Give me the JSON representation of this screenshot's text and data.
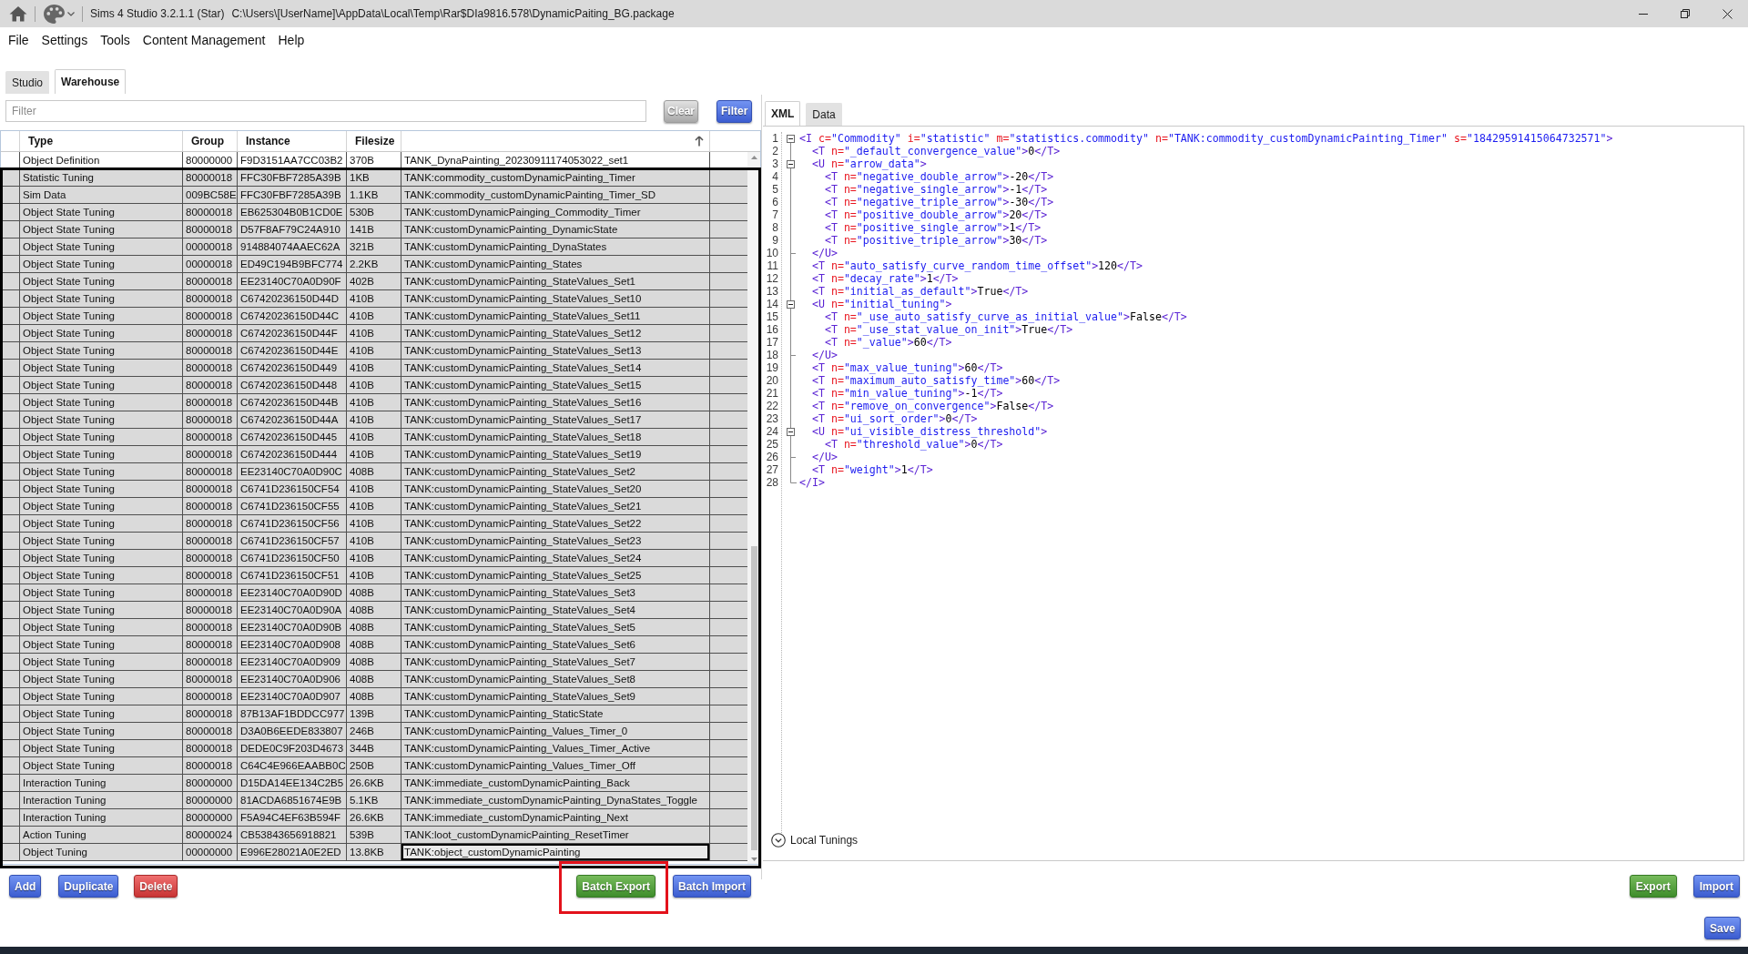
{
  "window": {
    "app_name": "Sims 4 Studio 3.2.1.1 (Star)",
    "file_path": "C:\\Users\\[UserName]\\AppData\\Local\\Temp\\Rar$DIa9816.578\\DynamicPaiting_BG.package"
  },
  "menu": [
    "File",
    "Settings",
    "Tools",
    "Content Management",
    "Help"
  ],
  "tabs": [
    {
      "label": "Studio",
      "selected": false
    },
    {
      "label": "Warehouse",
      "selected": true
    }
  ],
  "filter": {
    "placeholder": "Filter",
    "clear_button": {
      "label": "Clear",
      "disabled": true
    },
    "filter_button": {
      "label": "Filter"
    }
  },
  "table": {
    "highlighted": true,
    "columns": [
      {
        "label": "Type",
        "sorted": false
      },
      {
        "label": "Group",
        "sorted": false
      },
      {
        "label": "Instance",
        "sorted": false
      },
      {
        "label": "Filesize",
        "sorted": false
      },
      {
        "sorted": true
      }
    ],
    "rows": [
      {
        "type": "Object Definition",
        "group": "80000000",
        "instance": "F9D3151AA7CC03B2",
        "filesize": "370B",
        "column_5": "TANK_DynaPainting_20230911174053022_set1",
        "selected": false,
        "focused": false
      },
      {
        "type": "Statistic Tuning",
        "group": "80000018",
        "instance": "FFC30FBF7285A39B",
        "filesize": "1KB",
        "column_5": "TANK:commodity_customDynamicPainting_Timer",
        "selected": true,
        "focused": false
      },
      {
        "type": "Sim Data",
        "group": "009BC58E",
        "instance": "FFC30FBF7285A39B",
        "filesize": "1.1KB",
        "column_5": "TANK:commodity_customDynamicPainting_Timer_SD",
        "selected": true,
        "focused": false
      },
      {
        "type": "Object State Tuning",
        "group": "80000018",
        "instance": "EB625304B0B1CD0E",
        "filesize": "530B",
        "column_5": "TANK:customDynamicPainging_Commodity_Timer",
        "selected": true,
        "focused": false
      },
      {
        "type": "Object State Tuning",
        "group": "80000018",
        "instance": "D57F8AF79C24A910",
        "filesize": "141B",
        "column_5": "TANK:customDynamicPainting_DynamicState",
        "selected": true,
        "focused": false
      },
      {
        "type": "Object State Tuning",
        "group": "00000018",
        "instance": "914884074AAEC62A",
        "filesize": "321B",
        "column_5": "TANK:customDynamicPainting_DynaStates",
        "selected": true,
        "focused": false
      },
      {
        "type": "Object State Tuning",
        "group": "00000018",
        "instance": "ED49C194B9BFC774",
        "filesize": "2.2KB",
        "column_5": "TANK:customDynamicPainting_States",
        "selected": true,
        "focused": false
      },
      {
        "type": "Object State Tuning",
        "group": "80000018",
        "instance": "EE23140C70A0D90F",
        "filesize": "402B",
        "column_5": "TANK:customDynamicPainting_StateValues_Set1",
        "selected": true,
        "focused": false
      },
      {
        "type": "Object State Tuning",
        "group": "80000018",
        "instance": "C67420236150D44D",
        "filesize": "410B",
        "column_5": "TANK:customDynamicPainting_StateValues_Set10",
        "selected": true,
        "focused": false
      },
      {
        "type": "Object State Tuning",
        "group": "80000018",
        "instance": "C67420236150D44C",
        "filesize": "410B",
        "column_5": "TANK:customDynamicPainting_StateValues_Set11",
        "selected": true,
        "focused": false
      },
      {
        "type": "Object State Tuning",
        "group": "80000018",
        "instance": "C67420236150D44F",
        "filesize": "410B",
        "column_5": "TANK:customDynamicPainting_StateValues_Set12",
        "selected": true,
        "focused": false
      },
      {
        "type": "Object State Tuning",
        "group": "80000018",
        "instance": "C67420236150D44E",
        "filesize": "410B",
        "column_5": "TANK:customDynamicPainting_StateValues_Set13",
        "selected": true,
        "focused": false
      },
      {
        "type": "Object State Tuning",
        "group": "80000018",
        "instance": "C67420236150D449",
        "filesize": "410B",
        "column_5": "TANK:customDynamicPainting_StateValues_Set14",
        "selected": true,
        "focused": false
      },
      {
        "type": "Object State Tuning",
        "group": "80000018",
        "instance": "C67420236150D448",
        "filesize": "410B",
        "column_5": "TANK:customDynamicPainting_StateValues_Set15",
        "selected": true,
        "focused": false
      },
      {
        "type": "Object State Tuning",
        "group": "80000018",
        "instance": "C67420236150D44B",
        "filesize": "410B",
        "column_5": "TANK:customDynamicPainting_StateValues_Set16",
        "selected": true,
        "focused": false
      },
      {
        "type": "Object State Tuning",
        "group": "80000018",
        "instance": "C67420236150D44A",
        "filesize": "410B",
        "column_5": "TANK:customDynamicPainting_StateValues_Set17",
        "selected": true,
        "focused": false
      },
      {
        "type": "Object State Tuning",
        "group": "80000018",
        "instance": "C67420236150D445",
        "filesize": "410B",
        "column_5": "TANK:customDynamicPainting_StateValues_Set18",
        "selected": true,
        "focused": false
      },
      {
        "type": "Object State Tuning",
        "group": "80000018",
        "instance": "C67420236150D444",
        "filesize": "410B",
        "column_5": "TANK:customDynamicPainting_StateValues_Set19",
        "selected": true,
        "focused": false
      },
      {
        "type": "Object State Tuning",
        "group": "80000018",
        "instance": "EE23140C70A0D90C",
        "filesize": "408B",
        "column_5": "TANK:customDynamicPainting_StateValues_Set2",
        "selected": true,
        "focused": false
      },
      {
        "type": "Object State Tuning",
        "group": "80000018",
        "instance": "C6741D236150CF54",
        "filesize": "410B",
        "column_5": "TANK:customDynamicPainting_StateValues_Set20",
        "selected": true,
        "focused": false
      },
      {
        "type": "Object State Tuning",
        "group": "80000018",
        "instance": "C6741D236150CF55",
        "filesize": "410B",
        "column_5": "TANK:customDynamicPainting_StateValues_Set21",
        "selected": true,
        "focused": false
      },
      {
        "type": "Object State Tuning",
        "group": "80000018",
        "instance": "C6741D236150CF56",
        "filesize": "410B",
        "column_5": "TANK:customDynamicPainting_StateValues_Set22",
        "selected": true,
        "focused": false
      },
      {
        "type": "Object State Tuning",
        "group": "80000018",
        "instance": "C6741D236150CF57",
        "filesize": "410B",
        "column_5": "TANK:customDynamicPainting_StateValues_Set23",
        "selected": true,
        "focused": false
      },
      {
        "type": "Object State Tuning",
        "group": "80000018",
        "instance": "C6741D236150CF50",
        "filesize": "410B",
        "column_5": "TANK:customDynamicPainting_StateValues_Set24",
        "selected": true,
        "focused": false
      },
      {
        "type": "Object State Tuning",
        "group": "80000018",
        "instance": "C6741D236150CF51",
        "filesize": "410B",
        "column_5": "TANK:customDynamicPainting_StateValues_Set25",
        "selected": true,
        "focused": false
      },
      {
        "type": "Object State Tuning",
        "group": "80000018",
        "instance": "EE23140C70A0D90D",
        "filesize": "408B",
        "column_5": "TANK:customDynamicPainting_StateValues_Set3",
        "selected": true,
        "focused": false
      },
      {
        "type": "Object State Tuning",
        "group": "80000018",
        "instance": "EE23140C70A0D90A",
        "filesize": "408B",
        "column_5": "TANK:customDynamicPainting_StateValues_Set4",
        "selected": true,
        "focused": false
      },
      {
        "type": "Object State Tuning",
        "group": "80000018",
        "instance": "EE23140C70A0D90B",
        "filesize": "408B",
        "column_5": "TANK:customDynamicPainting_StateValues_Set5",
        "selected": true,
        "focused": false
      },
      {
        "type": "Object State Tuning",
        "group": "80000018",
        "instance": "EE23140C70A0D908",
        "filesize": "408B",
        "column_5": "TANK:customDynamicPainting_StateValues_Set6",
        "selected": true,
        "focused": false
      },
      {
        "type": "Object State Tuning",
        "group": "80000018",
        "instance": "EE23140C70A0D909",
        "filesize": "408B",
        "column_5": "TANK:customDynamicPainting_StateValues_Set7",
        "selected": true,
        "focused": false
      },
      {
        "type": "Object State Tuning",
        "group": "80000018",
        "instance": "EE23140C70A0D906",
        "filesize": "408B",
        "column_5": "TANK:customDynamicPainting_StateValues_Set8",
        "selected": true,
        "focused": false
      },
      {
        "type": "Object State Tuning",
        "group": "80000018",
        "instance": "EE23140C70A0D907",
        "filesize": "408B",
        "column_5": "TANK:customDynamicPainting_StateValues_Set9",
        "selected": true,
        "focused": false
      },
      {
        "type": "Object State Tuning",
        "group": "80000018",
        "instance": "87B13AF1BDDCC977",
        "filesize": "139B",
        "column_5": "TANK:customDynamicPainting_StaticState",
        "selected": true,
        "focused": false
      },
      {
        "type": "Object State Tuning",
        "group": "80000018",
        "instance": "D3A0B6EEDE833807",
        "filesize": "246B",
        "column_5": "TANK:customDynamicPainting_Values_Timer_0",
        "selected": true,
        "focused": false
      },
      {
        "type": "Object State Tuning",
        "group": "80000018",
        "instance": "DEDE0C9F203D4673",
        "filesize": "344B",
        "column_5": "TANK:customDynamicPainting_Values_Timer_Active",
        "selected": true,
        "focused": false
      },
      {
        "type": "Object State Tuning",
        "group": "80000018",
        "instance": "C64C4E966EAABB0C",
        "filesize": "250B",
        "column_5": "TANK:customDynamicPainting_Values_Timer_Off",
        "selected": true,
        "focused": false
      },
      {
        "type": "Interaction Tuning",
        "group": "80000000",
        "instance": "D15DA14EE134C2B5",
        "filesize": "26.6KB",
        "column_5": "TANK:immediate_customDynamicPainting_Back",
        "selected": true,
        "focused": false
      },
      {
        "type": "Interaction Tuning",
        "group": "80000000",
        "instance": "81ACDA6851674E9B",
        "filesize": "5.1KB",
        "column_5": "TANK:immediate_customDynamicPainting_DynaStates_Toggle",
        "selected": true,
        "focused": false
      },
      {
        "type": "Interaction Tuning",
        "group": "80000000",
        "instance": "F5A94C4EF63B594F",
        "filesize": "26.6KB",
        "column_5": "TANK:immediate_customDynamicPainting_Next",
        "selected": true,
        "focused": false
      },
      {
        "type": "Action Tuning",
        "group": "80000024",
        "instance": "CB53843656918821",
        "filesize": "539B",
        "column_5": "TANK:loot_customDynamicPainting_ResetTimer",
        "selected": true,
        "focused": false
      },
      {
        "type": "Object Tuning",
        "group": "00000000",
        "instance": "E996E28021A0E2ED",
        "filesize": "13.8KB",
        "column_5": "TANK:object_customDynamicPainting",
        "selected": true,
        "focused": true
      }
    ]
  },
  "record_buttons": [
    {
      "label": "Add",
      "kind": "primary"
    },
    {
      "label": "Duplicate",
      "kind": "primary"
    },
    {
      "label": "Delete",
      "kind": "danger"
    }
  ],
  "batch_buttons": [
    {
      "label": "Batch Export",
      "kind": "success",
      "highlighted": true
    },
    {
      "label": "Batch Import",
      "kind": "primary",
      "highlighted": false
    }
  ],
  "editor": {
    "tabs": [
      {
        "label": "XML",
        "selected": true
      },
      {
        "label": "Data",
        "selected": false
      }
    ],
    "lines": [
      {
        "number": "1",
        "kind": "open",
        "text": "<I c=\"Commodity\" i=\"statistic\" m=\"statistics.commodity\" n=\"TANK:commodity_customDynamicPainting_Timer\" s=\"18429591415064732571\">"
      },
      {
        "number": "2",
        "kind": "plain",
        "text": "  <T n=\"_default_convergence_value\">0</T>"
      },
      {
        "number": "3",
        "kind": "open",
        "text": "  <U n=\"arrow_data\">"
      },
      {
        "number": "4",
        "kind": "plain",
        "text": "    <T n=\"negative_double_arrow\">-20</T>"
      },
      {
        "number": "5",
        "kind": "plain",
        "text": "    <T n=\"negative_single_arrow\">-1</T>"
      },
      {
        "number": "6",
        "kind": "plain",
        "text": "    <T n=\"negative_triple_arrow\">-30</T>"
      },
      {
        "number": "7",
        "kind": "plain",
        "text": "    <T n=\"positive_double_arrow\">20</T>"
      },
      {
        "number": "8",
        "kind": "plain",
        "text": "    <T n=\"positive_single_arrow\">1</T>"
      },
      {
        "number": "9",
        "kind": "plain",
        "text": "    <T n=\"positive_triple_arrow\">30</T>"
      },
      {
        "number": "10",
        "kind": "close",
        "text": "  </U>"
      },
      {
        "number": "11",
        "kind": "plain",
        "text": "  <T n=\"auto_satisfy_curve_random_time_offset\">120</T>"
      },
      {
        "number": "12",
        "kind": "plain",
        "text": "  <T n=\"decay_rate\">1</T>"
      },
      {
        "number": "13",
        "kind": "plain",
        "text": "  <T n=\"initial_as_default\">True</T>"
      },
      {
        "number": "14",
        "kind": "open",
        "text": "  <U n=\"initial_tuning\">"
      },
      {
        "number": "15",
        "kind": "plain",
        "text": "    <T n=\"_use_auto_satisfy_curve_as_initial_value\">False</T>"
      },
      {
        "number": "16",
        "kind": "plain",
        "text": "    <T n=\"_use_stat_value_on_init\">True</T>"
      },
      {
        "number": "17",
        "kind": "plain",
        "text": "    <T n=\"_value\">60</T>"
      },
      {
        "number": "18",
        "kind": "close",
        "text": "  </U>"
      },
      {
        "number": "19",
        "kind": "plain",
        "text": "  <T n=\"max_value_tuning\">60</T>"
      },
      {
        "number": "20",
        "kind": "plain",
        "text": "  <T n=\"maximum_auto_satisfy_time\">60</T>"
      },
      {
        "number": "21",
        "kind": "plain",
        "text": "  <T n=\"min_value_tuning\">-1</T>"
      },
      {
        "number": "22",
        "kind": "plain",
        "text": "  <T n=\"remove_on_convergence\">False</T>"
      },
      {
        "number": "23",
        "kind": "plain",
        "text": "  <T n=\"ui_sort_order\">0</T>"
      },
      {
        "number": "24",
        "kind": "open",
        "text": "  <U n=\"ui_visible_distress_threshold\">"
      },
      {
        "number": "25",
        "kind": "plain",
        "text": "    <T n=\"threshold_value\">0</T>"
      },
      {
        "number": "26",
        "kind": "close",
        "text": "  </U>"
      },
      {
        "number": "27",
        "kind": "plain",
        "text": "  <T n=\"weight\">1</T>"
      },
      {
        "number": "28",
        "kind": "last",
        "text": "</I>"
      }
    ],
    "local_tunings": {
      "label": "Local Tunings"
    },
    "buttons": [
      {
        "label": "Export",
        "kind": "success"
      },
      {
        "label": "Import",
        "kind": "primary"
      }
    ],
    "save_button": {
      "label": "Save"
    }
  }
}
